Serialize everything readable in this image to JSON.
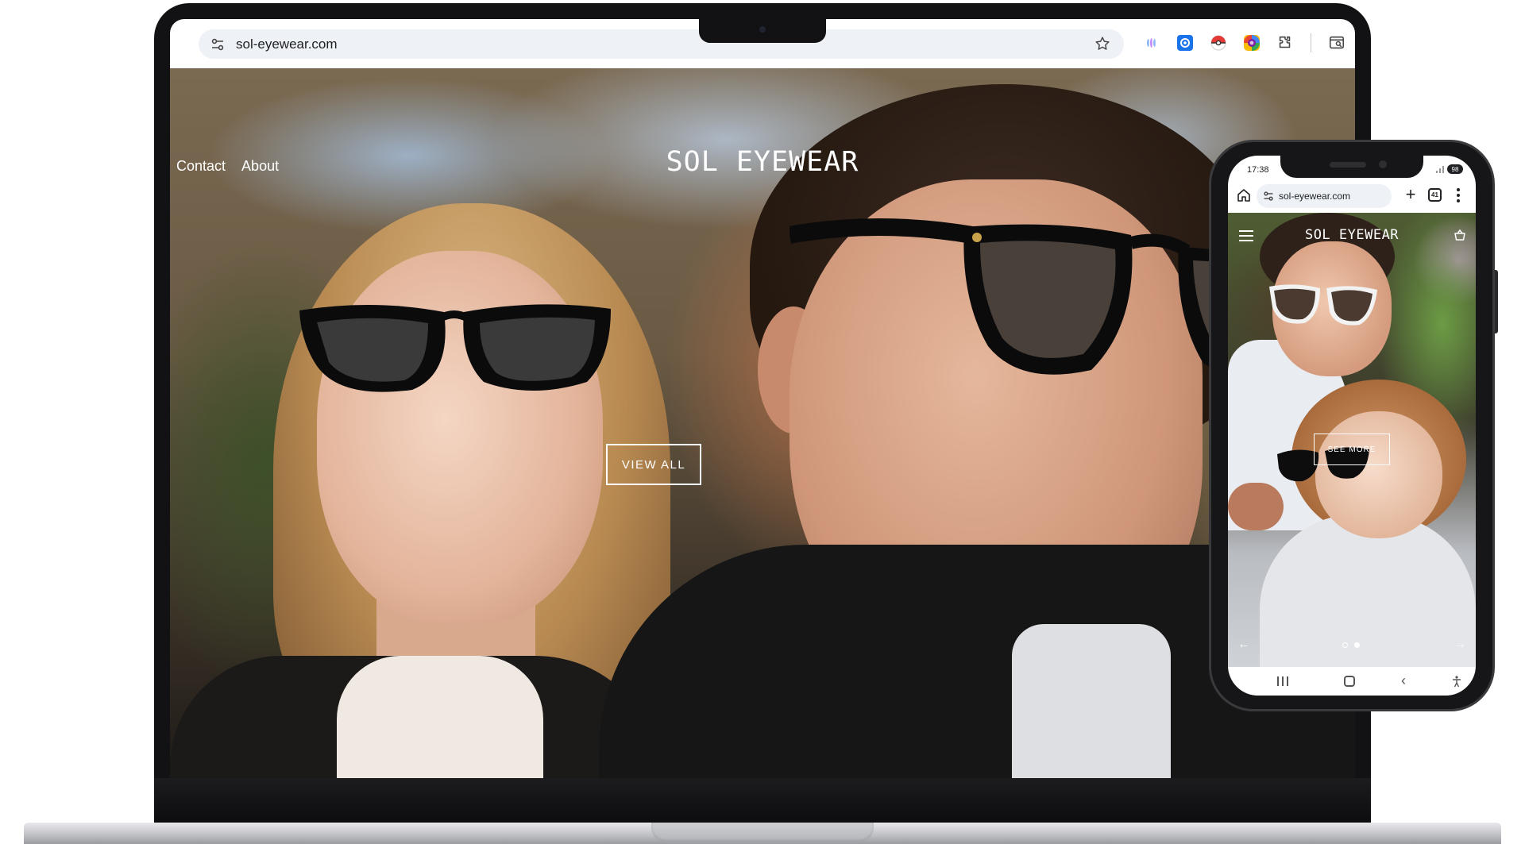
{
  "desktop": {
    "browser": {
      "url": "sol-eyewear.com"
    },
    "site": {
      "nav": [
        "Contact",
        "About"
      ],
      "brand": "SOL EYEWEAR",
      "cta": "VIEW ALL"
    }
  },
  "mobile": {
    "status": {
      "time": "17:38",
      "battery": "98"
    },
    "browser": {
      "url": "sol-eyewear.com",
      "tab_count": "41"
    },
    "site": {
      "brand": "SOL EYEWEAR",
      "cta": "SEE MORE",
      "slides_total": 2,
      "slide_active": 2
    }
  },
  "colors": {
    "browser_chrome": "#ffffff",
    "url_pill": "#eef1f6",
    "overlay_text": "#ffffff",
    "device_frame": "#121214"
  },
  "icons": {
    "desktop_toolbar": [
      "tune-icon",
      "star-icon",
      "gemini-icon",
      "settings-extension-icon",
      "pokeball-extension-icon",
      "colorful-extension-icon",
      "puzzle-extension-icon",
      "side-panel-search-icon"
    ],
    "site_header": [
      "user-icon"
    ],
    "mobile_toolbar": [
      "home-icon",
      "tune-icon",
      "plus-icon",
      "tabs-icon",
      "kebab-menu-icon"
    ],
    "mobile_site": [
      "hamburger-menu-icon",
      "cart-basket-icon",
      "arrow-left-icon",
      "arrow-right-icon"
    ],
    "android_nav": [
      "recents-icon",
      "home-icon",
      "back-icon",
      "accessibility-icon"
    ]
  }
}
